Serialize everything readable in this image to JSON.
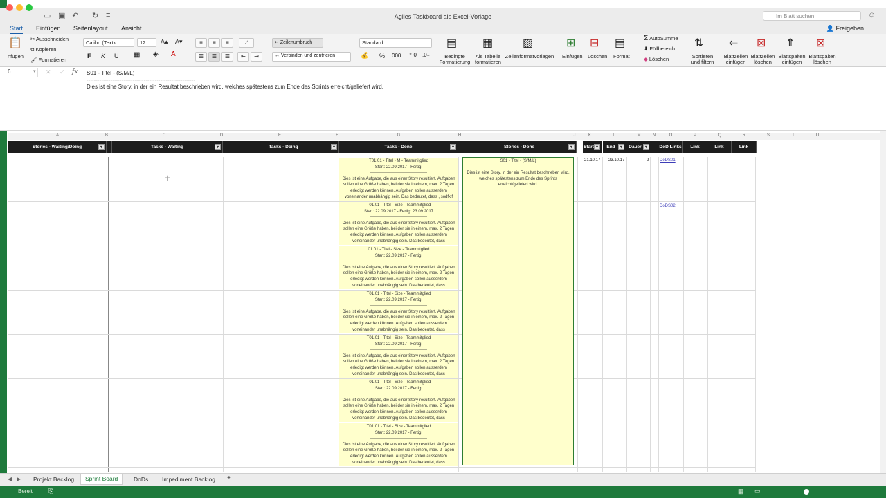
{
  "window": {
    "title": "Agiles Taskboard als Excel-Vorlage",
    "search_placeholder": "Im Blatt suchen"
  },
  "ribbon_tabs": [
    "Start",
    "Einfügen",
    "Seitenlayout",
    "Ansicht"
  ],
  "share_label": "Freigeben",
  "clipboard": {
    "paste": "nfügen",
    "cut": "Ausschneiden",
    "copy": "Kopieren",
    "format": "Formatieren"
  },
  "font": {
    "name": "Calibri (Textk...",
    "size": "12",
    "bold": "F",
    "italic": "K",
    "underline": "U"
  },
  "alignment": {
    "wrap": "Zeilenumbruch",
    "merge": "Verbinden und zentrieren"
  },
  "number": {
    "format": "Standard",
    "percent": "%",
    "thousands": "000"
  },
  "styles": {
    "conditional": "Bedingte Formatierung",
    "as_table": "Als Tabelle formatieren",
    "cell_styles": "Zellenformatvorlagen"
  },
  "cells": {
    "insert": "Einfügen",
    "delete": "Löschen",
    "format": "Format"
  },
  "editing": {
    "autosum": "AutoSumme",
    "fill": "Füllbereich",
    "clear": "Löschen",
    "sort": "Sortieren und filtern"
  },
  "sheet_ops": {
    "insert_rows": "Blattzeilen einfügen",
    "delete_rows": "Blattzeilen löschen",
    "insert_cols": "Blattspalten einfügen",
    "delete_cols": "Blattspalten löschen"
  },
  "formula_bar": {
    "cell_ref": "6",
    "fx": "fx",
    "line1": "S01 - Titel - (S/M/L)",
    "line2": "-----------------------------------------------------------",
    "line3": "Dies ist eine Story, in der ein Resultat beschrieben wird, welches spätestens zum Ende des Sprints erreicht/geliefert wird."
  },
  "column_letters": [
    "A",
    "B",
    "C",
    "D",
    "E",
    "F",
    "G",
    "H",
    "I",
    "J",
    "K",
    "L",
    "M",
    "N",
    "O",
    "P",
    "Q",
    "R",
    "S",
    "T",
    "U"
  ],
  "headers": [
    "Stories - Waiting/Doing",
    "Tasks - Waiting",
    "Tasks - Doing",
    "Tasks - Done",
    "Stories - Done",
    "Start",
    "End",
    "Dauer",
    "DoD Links",
    "Link",
    "Link",
    "Link"
  ],
  "tasks": [
    {
      "title": "T01.01 - Titel - M - Teammitglied",
      "dates": "Start: 22.09.2017 - Fertig:",
      "sep": "-----------------------------------------",
      "body": "Dies ist eine Aufgabe, die aus einer Story resultiert. Aufgaben sollen eine Größe haben, bei der sie in einem, max. 2 Tagen erledigt werden können. Aufgaben sollen ausserdem voneinander unabhängig sein. Das bedeutet, dass , sodfkjf"
    },
    {
      "title": "T01.01 - Titel - Size - Teammitglied",
      "dates": "Start: 22.09.2017 - Fertig: 23.09.2017",
      "sep": "-----------------------------------------",
      "body": "Dies ist eine Aufgabe, die aus einer Story resultiert. Aufgaben sollen eine Größe haben, bei der sie in einem, max. 2 Tagen erledigt werden können. Aufgaben sollen ausserdem voneinander unabhängig sein. Das bedeutet, dass"
    },
    {
      "title": "01.01 - Titel - Size - Teammitglied",
      "dates": "Start: 22.09.2017 - Fertig:",
      "sep": "-----------------------------------------",
      "body": "Dies ist eine Aufgabe, die aus einer Story resultiert. Aufgaben sollen eine Größe haben, bei der sie in einem, max. 2 Tagen erledigt werden können. Aufgaben sollen ausserdem voneinander unabhängig sein. Das bedeutet, dass"
    },
    {
      "title": "T01.01 - Titel - Size - Teammitglied",
      "dates": "Start: 22.09.2017 - Fertig:",
      "sep": "-----------------------------------------",
      "body": "Dies ist eine Aufgabe, die aus einer Story resultiert. Aufgaben sollen eine Größe haben, bei der sie in einem, max. 2 Tagen erledigt werden können. Aufgaben sollen ausserdem voneinander unabhängig sein. Das bedeutet, dass"
    },
    {
      "title": "T01.01 - Titel - Size - Teammitglied",
      "dates": "Start: 22.09.2017 - Fertig:",
      "sep": "-----------------------------------------",
      "body": "Dies ist eine Aufgabe, die aus einer Story resultiert. Aufgaben sollen eine Größe haben, bei der sie in einem, max. 2 Tagen erledigt werden können. Aufgaben sollen ausserdem voneinander unabhängig sein. Das bedeutet, dass"
    },
    {
      "title": "T01.01 - Titel - Size - Teammitglied",
      "dates": "Start: 22.09.2017 - Fertig:",
      "sep": "-----------------------------------------",
      "body": "Dies ist eine Aufgabe, die aus einer Story resultiert. Aufgaben sollen eine Größe haben, bei der sie in einem, max. 2 Tagen erledigt werden können. Aufgaben sollen ausserdem voneinander unabhängig sein. Das bedeutet, dass"
    },
    {
      "title": "T01.01 - Titel - Size - Teammitglied",
      "dates": "Start: 22.09.2017 - Fertig:",
      "sep": "-----------------------------------------",
      "body": "Dies ist eine Aufgabe, die aus einer Story resultiert. Aufgaben sollen eine Größe haben, bei der sie in einem, max. 2 Tagen erledigt werden können. Aufgaben sollen ausserdem voneinander unabhängig sein. Das bedeutet, dass"
    }
  ],
  "story": {
    "title": "S01 - Titel - (S/M/L)",
    "sep": "-----------------------------------------",
    "body": "Dies ist eine Story, in der ein Resultat beschrieben wird, welches spätestens zum Ende des Sprints erreicht/geliefert wird."
  },
  "row1_values": {
    "start": "21.10.17",
    "end": "23.10.17",
    "dauer": "2",
    "dod1": "DoDS01"
  },
  "row2_values": {
    "dod2": "DoDS02"
  },
  "sheet_tabs": [
    "Projekt Backlog",
    "Sprint Board",
    "DoDs",
    "Impediment Backlog"
  ],
  "add_sheet": "+",
  "status": "Bereit",
  "colors": {
    "accent_green": "#1e7a3c",
    "header_black": "#1d1d1d",
    "card_yellow": "#ffffcc"
  }
}
